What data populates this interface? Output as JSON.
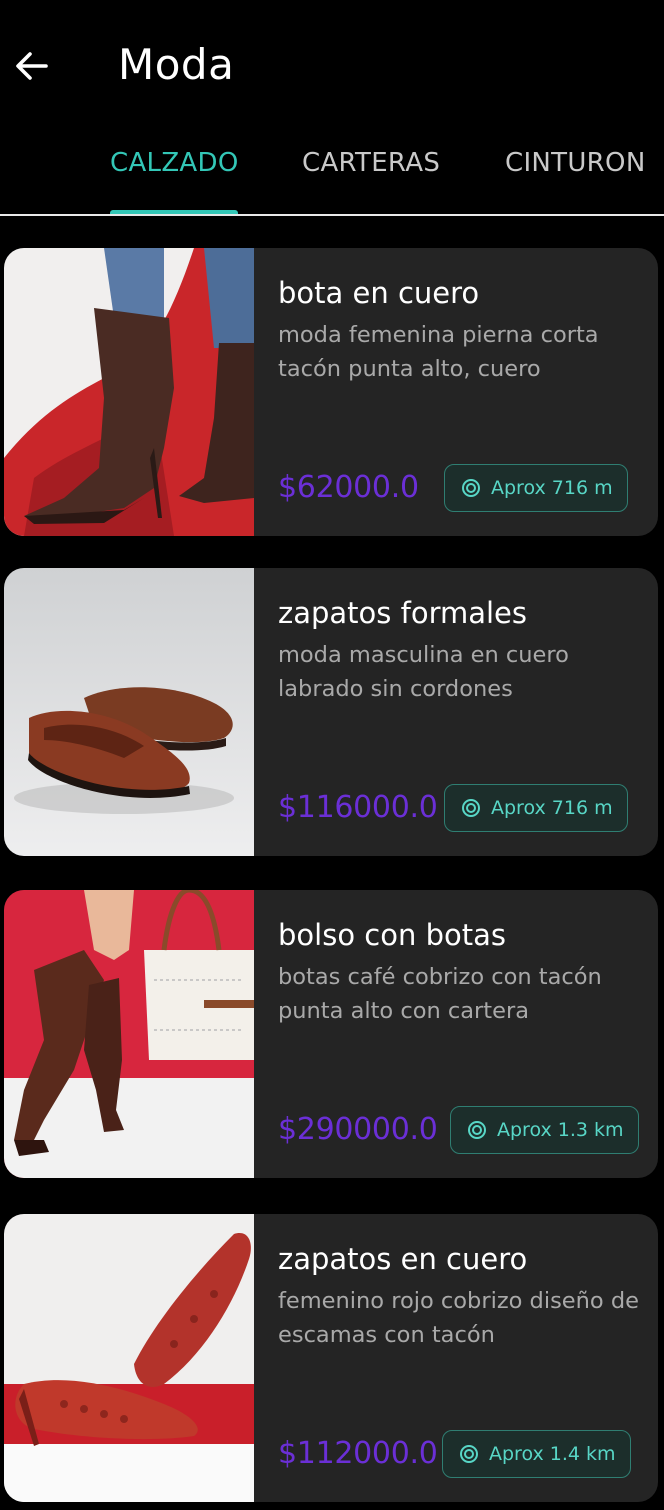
{
  "header": {
    "title": "Moda"
  },
  "tabs": [
    {
      "label": "CALZADO",
      "active": true
    },
    {
      "label": "CARTERAS",
      "active": false
    },
    {
      "label": "CINTURON",
      "active": false
    }
  ],
  "products": [
    {
      "title": "bota en cuero",
      "description": "moda femenina pierna corta tacón punta alto, cuero",
      "price": "$62000.0",
      "distance": "Aprox 716 m",
      "image": "brown-leather-ankle-boots"
    },
    {
      "title": "zapatos formales",
      "description": "moda masculina en cuero labrado sin cordones",
      "price": "$116000.0",
      "distance": "Aprox 716 m",
      "image": "woven-leather-loafers"
    },
    {
      "title": "bolso con botas",
      "description": "botas café cobrizo con tacón punta alto con cartera",
      "price": "$290000.0",
      "distance": "Aprox 1.3 km",
      "image": "knee-boots-with-white-handbag"
    },
    {
      "title": "zapatos en cuero",
      "description": "femenino rojo cobrizo diseño de escamas con tacón",
      "price": "$112000.0",
      "distance": "Aprox 1.4 km",
      "image": "red-snakeskin-pumps"
    }
  ],
  "icons": {
    "back": "arrow-left-icon",
    "distance": "target-icon"
  },
  "colors": {
    "accent": "#33c7b7",
    "price": "#6b2fd6",
    "card_bg": "#242424",
    "chip_text": "#58d6c6"
  }
}
